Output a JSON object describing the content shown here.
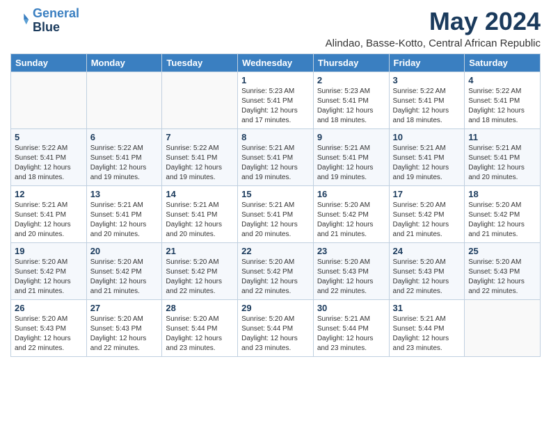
{
  "logo": {
    "line1": "General",
    "line2": "Blue"
  },
  "title": "May 2024",
  "subtitle": "Alindao, Basse-Kotto, Central African Republic",
  "days_of_week": [
    "Sunday",
    "Monday",
    "Tuesday",
    "Wednesday",
    "Thursday",
    "Friday",
    "Saturday"
  ],
  "weeks": [
    [
      {
        "day": "",
        "info": ""
      },
      {
        "day": "",
        "info": ""
      },
      {
        "day": "",
        "info": ""
      },
      {
        "day": "1",
        "info": "Sunrise: 5:23 AM\nSunset: 5:41 PM\nDaylight: 12 hours\nand 17 minutes."
      },
      {
        "day": "2",
        "info": "Sunrise: 5:23 AM\nSunset: 5:41 PM\nDaylight: 12 hours\nand 18 minutes."
      },
      {
        "day": "3",
        "info": "Sunrise: 5:22 AM\nSunset: 5:41 PM\nDaylight: 12 hours\nand 18 minutes."
      },
      {
        "day": "4",
        "info": "Sunrise: 5:22 AM\nSunset: 5:41 PM\nDaylight: 12 hours\nand 18 minutes."
      }
    ],
    [
      {
        "day": "5",
        "info": "Sunrise: 5:22 AM\nSunset: 5:41 PM\nDaylight: 12 hours\nand 18 minutes."
      },
      {
        "day": "6",
        "info": "Sunrise: 5:22 AM\nSunset: 5:41 PM\nDaylight: 12 hours\nand 19 minutes."
      },
      {
        "day": "7",
        "info": "Sunrise: 5:22 AM\nSunset: 5:41 PM\nDaylight: 12 hours\nand 19 minutes."
      },
      {
        "day": "8",
        "info": "Sunrise: 5:21 AM\nSunset: 5:41 PM\nDaylight: 12 hours\nand 19 minutes."
      },
      {
        "day": "9",
        "info": "Sunrise: 5:21 AM\nSunset: 5:41 PM\nDaylight: 12 hours\nand 19 minutes."
      },
      {
        "day": "10",
        "info": "Sunrise: 5:21 AM\nSunset: 5:41 PM\nDaylight: 12 hours\nand 19 minutes."
      },
      {
        "day": "11",
        "info": "Sunrise: 5:21 AM\nSunset: 5:41 PM\nDaylight: 12 hours\nand 20 minutes."
      }
    ],
    [
      {
        "day": "12",
        "info": "Sunrise: 5:21 AM\nSunset: 5:41 PM\nDaylight: 12 hours\nand 20 minutes."
      },
      {
        "day": "13",
        "info": "Sunrise: 5:21 AM\nSunset: 5:41 PM\nDaylight: 12 hours\nand 20 minutes."
      },
      {
        "day": "14",
        "info": "Sunrise: 5:21 AM\nSunset: 5:41 PM\nDaylight: 12 hours\nand 20 minutes."
      },
      {
        "day": "15",
        "info": "Sunrise: 5:21 AM\nSunset: 5:41 PM\nDaylight: 12 hours\nand 20 minutes."
      },
      {
        "day": "16",
        "info": "Sunrise: 5:20 AM\nSunset: 5:42 PM\nDaylight: 12 hours\nand 21 minutes."
      },
      {
        "day": "17",
        "info": "Sunrise: 5:20 AM\nSunset: 5:42 PM\nDaylight: 12 hours\nand 21 minutes."
      },
      {
        "day": "18",
        "info": "Sunrise: 5:20 AM\nSunset: 5:42 PM\nDaylight: 12 hours\nand 21 minutes."
      }
    ],
    [
      {
        "day": "19",
        "info": "Sunrise: 5:20 AM\nSunset: 5:42 PM\nDaylight: 12 hours\nand 21 minutes."
      },
      {
        "day": "20",
        "info": "Sunrise: 5:20 AM\nSunset: 5:42 PM\nDaylight: 12 hours\nand 21 minutes."
      },
      {
        "day": "21",
        "info": "Sunrise: 5:20 AM\nSunset: 5:42 PM\nDaylight: 12 hours\nand 22 minutes."
      },
      {
        "day": "22",
        "info": "Sunrise: 5:20 AM\nSunset: 5:42 PM\nDaylight: 12 hours\nand 22 minutes."
      },
      {
        "day": "23",
        "info": "Sunrise: 5:20 AM\nSunset: 5:43 PM\nDaylight: 12 hours\nand 22 minutes."
      },
      {
        "day": "24",
        "info": "Sunrise: 5:20 AM\nSunset: 5:43 PM\nDaylight: 12 hours\nand 22 minutes."
      },
      {
        "day": "25",
        "info": "Sunrise: 5:20 AM\nSunset: 5:43 PM\nDaylight: 12 hours\nand 22 minutes."
      }
    ],
    [
      {
        "day": "26",
        "info": "Sunrise: 5:20 AM\nSunset: 5:43 PM\nDaylight: 12 hours\nand 22 minutes."
      },
      {
        "day": "27",
        "info": "Sunrise: 5:20 AM\nSunset: 5:43 PM\nDaylight: 12 hours\nand 22 minutes."
      },
      {
        "day": "28",
        "info": "Sunrise: 5:20 AM\nSunset: 5:44 PM\nDaylight: 12 hours\nand 23 minutes."
      },
      {
        "day": "29",
        "info": "Sunrise: 5:20 AM\nSunset: 5:44 PM\nDaylight: 12 hours\nand 23 minutes."
      },
      {
        "day": "30",
        "info": "Sunrise: 5:21 AM\nSunset: 5:44 PM\nDaylight: 12 hours\nand 23 minutes."
      },
      {
        "day": "31",
        "info": "Sunrise: 5:21 AM\nSunset: 5:44 PM\nDaylight: 12 hours\nand 23 minutes."
      },
      {
        "day": "",
        "info": ""
      }
    ]
  ]
}
